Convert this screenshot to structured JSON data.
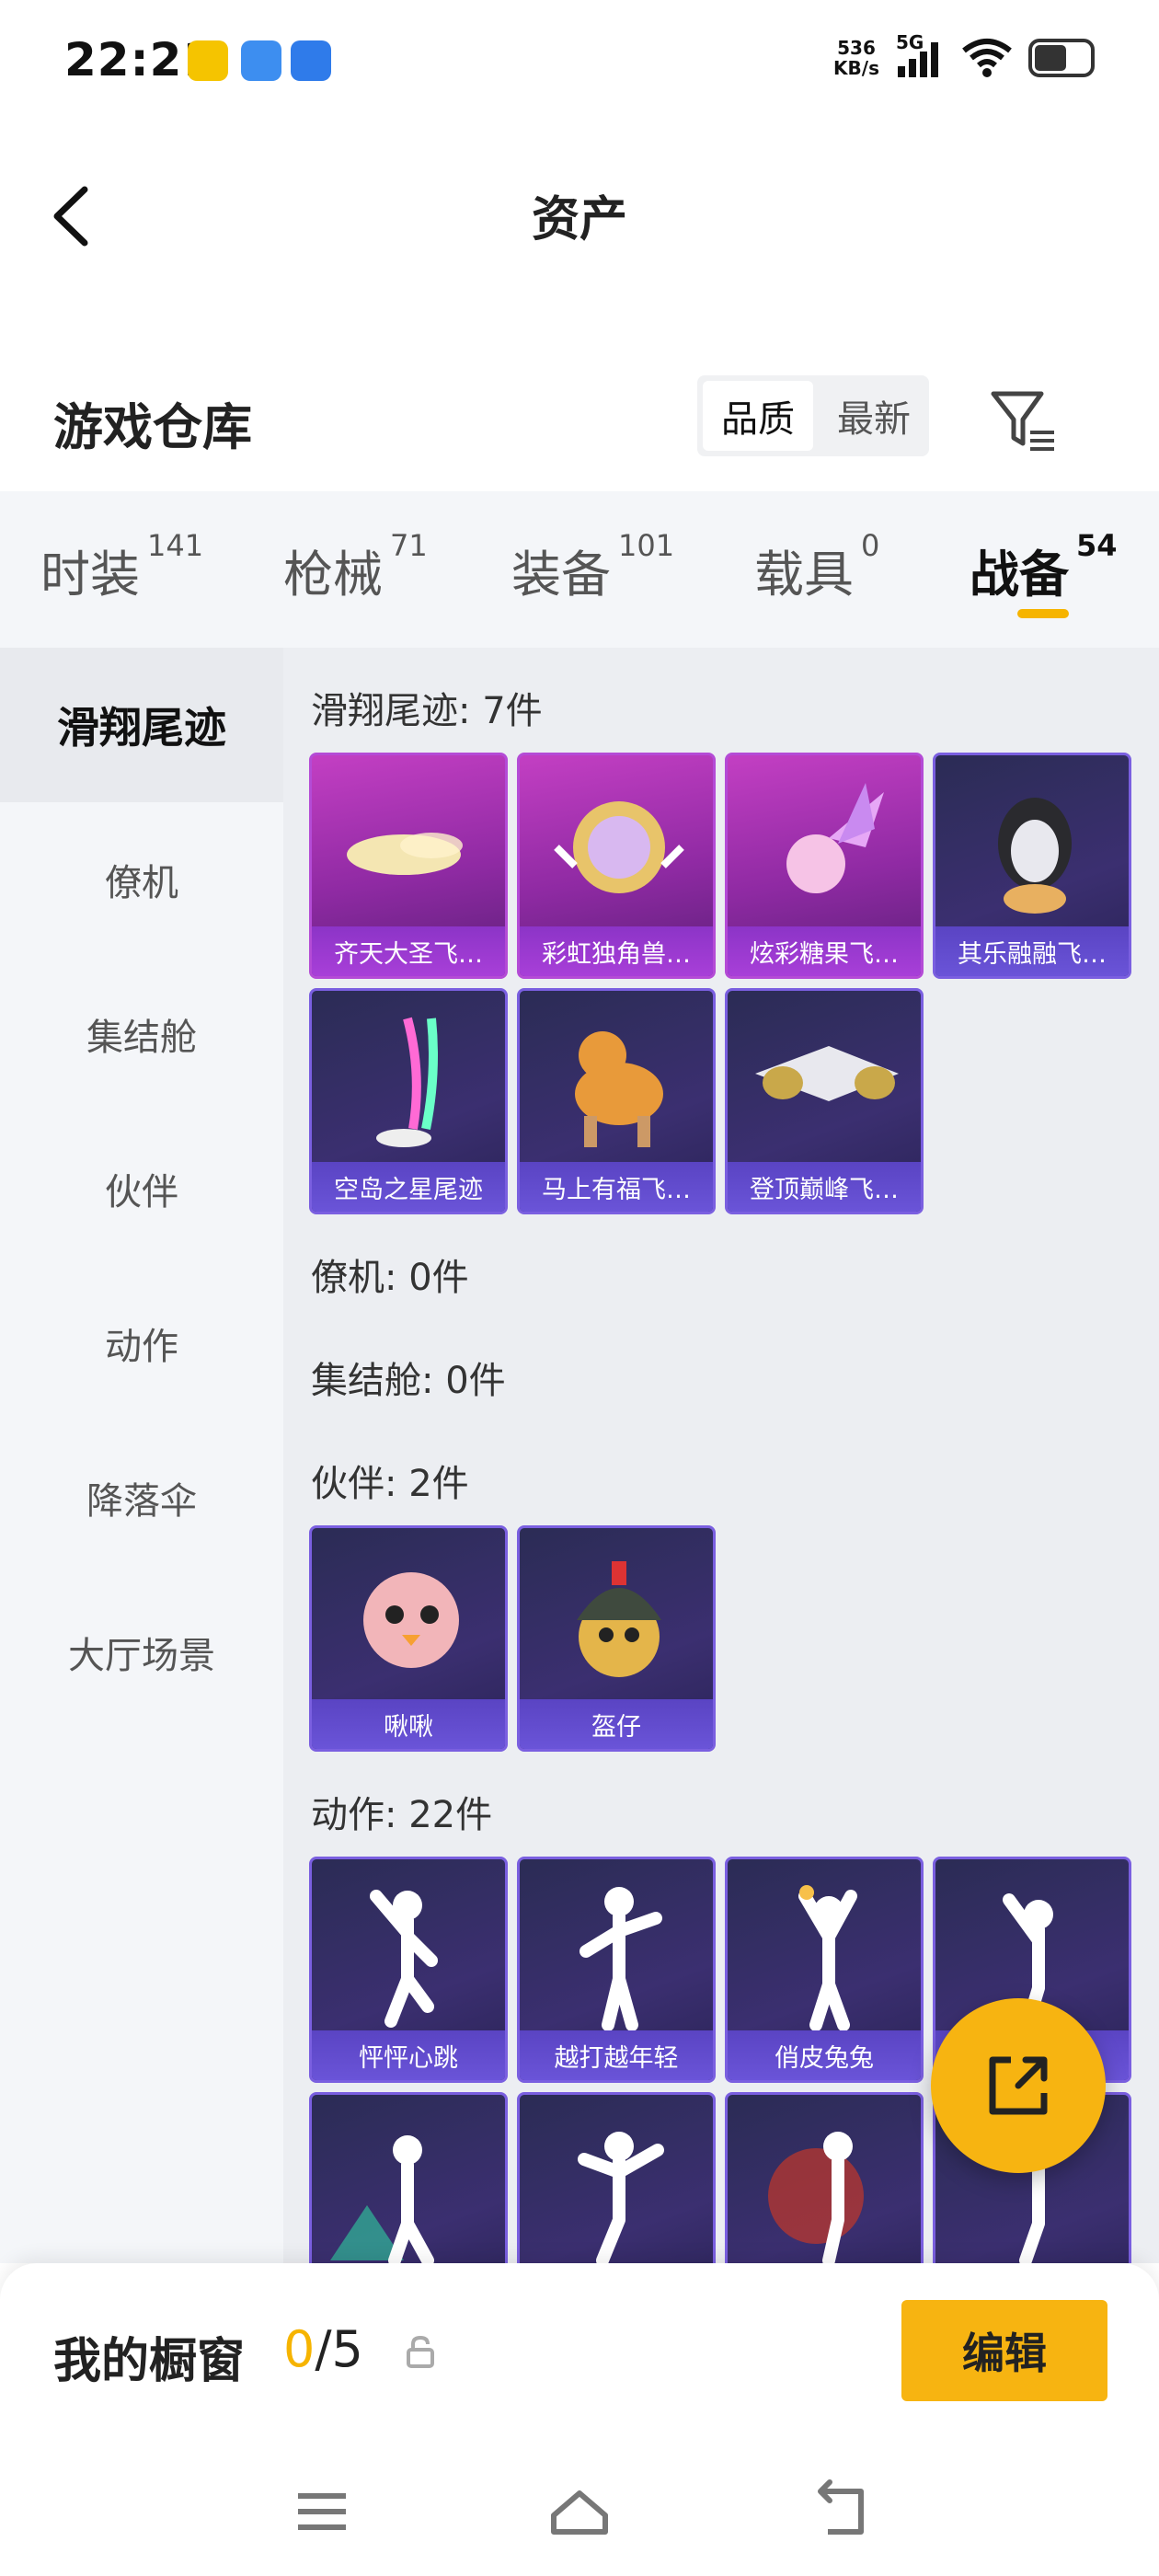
{
  "status": {
    "time": "22:21",
    "speed_value": "536",
    "speed_unit": "KB/s",
    "network": "5G"
  },
  "header": {
    "title": "资产"
  },
  "warehouse": {
    "title": "游戏仓库",
    "sort_options": [
      "品质",
      "最新"
    ],
    "sort_selected": "品质"
  },
  "tabs": [
    {
      "label": "时装",
      "count": "141"
    },
    {
      "label": "枪械",
      "count": "71"
    },
    {
      "label": "装备",
      "count": "101"
    },
    {
      "label": "载具",
      "count": "0"
    },
    {
      "label": "战备",
      "count": "54",
      "active": true
    }
  ],
  "sidebar": {
    "items": [
      "滑翔尾迹",
      "僚机",
      "集结舱",
      "伙伴",
      "动作",
      "降落伞",
      "大厅场景"
    ],
    "active": "滑翔尾迹"
  },
  "sections": {
    "glide": {
      "title": "滑翔尾迹: 7件",
      "items": [
        "齐天大圣飞…",
        "彩虹独角兽…",
        "炫彩糖果飞…",
        "其乐融融飞…",
        "空岛之星尾迹",
        "马上有福飞…",
        "登顶巅峰飞…"
      ]
    },
    "wingman": {
      "title": "僚机: 0件"
    },
    "capsule": {
      "title": "集结舱: 0件"
    },
    "partner": {
      "title": "伙伴: 2件",
      "items": [
        "啾啾",
        "盔仔"
      ]
    },
    "emote": {
      "title": "动作: 22件",
      "items": [
        "怦怦心跳",
        "越打越年轻",
        "俏皮兔兔"
      ]
    }
  },
  "showcase": {
    "label": "我的橱窗",
    "current": "0",
    "total": "/5",
    "edit": "编辑"
  },
  "colors": {
    "accent": "#f7b411",
    "card_purple": "#5a44c3",
    "card_pink": "#a83fd8"
  },
  "icons": [
    "back-icon",
    "filter-icon",
    "share-icon",
    "lock-icon",
    "menu-icon",
    "home-icon",
    "return-icon"
  ]
}
